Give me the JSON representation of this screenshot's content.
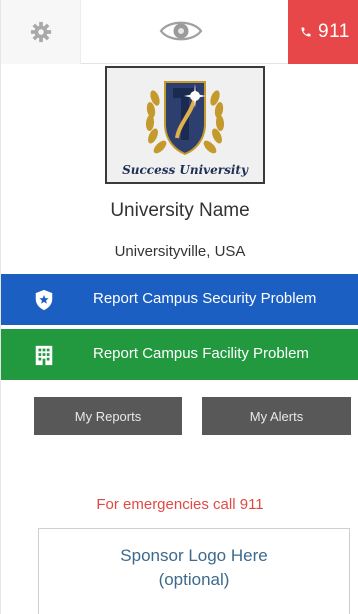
{
  "topbar": {
    "settings_icon": "gear-icon",
    "view_icon": "eye-icon",
    "call_icon": "phone-icon",
    "call_label": "911",
    "call_color": "#e8474a"
  },
  "header": {
    "logo_text": "Success University",
    "university_name": "University Name",
    "university_location": "Universityville, USA"
  },
  "actions": {
    "security": {
      "label": "Report Campus Security Problem",
      "icon": "shield-star-icon",
      "color": "#1b5fc2"
    },
    "facility": {
      "label": "Report Campus Facility Problem",
      "icon": "building-icon",
      "color": "#22993f"
    }
  },
  "buttons": {
    "my_reports": "My Reports",
    "my_alerts": "My Alerts"
  },
  "emergency_text": "For emergencies call 911",
  "sponsor": {
    "line1": "Sponsor Logo Here",
    "line2": "(optional)"
  }
}
